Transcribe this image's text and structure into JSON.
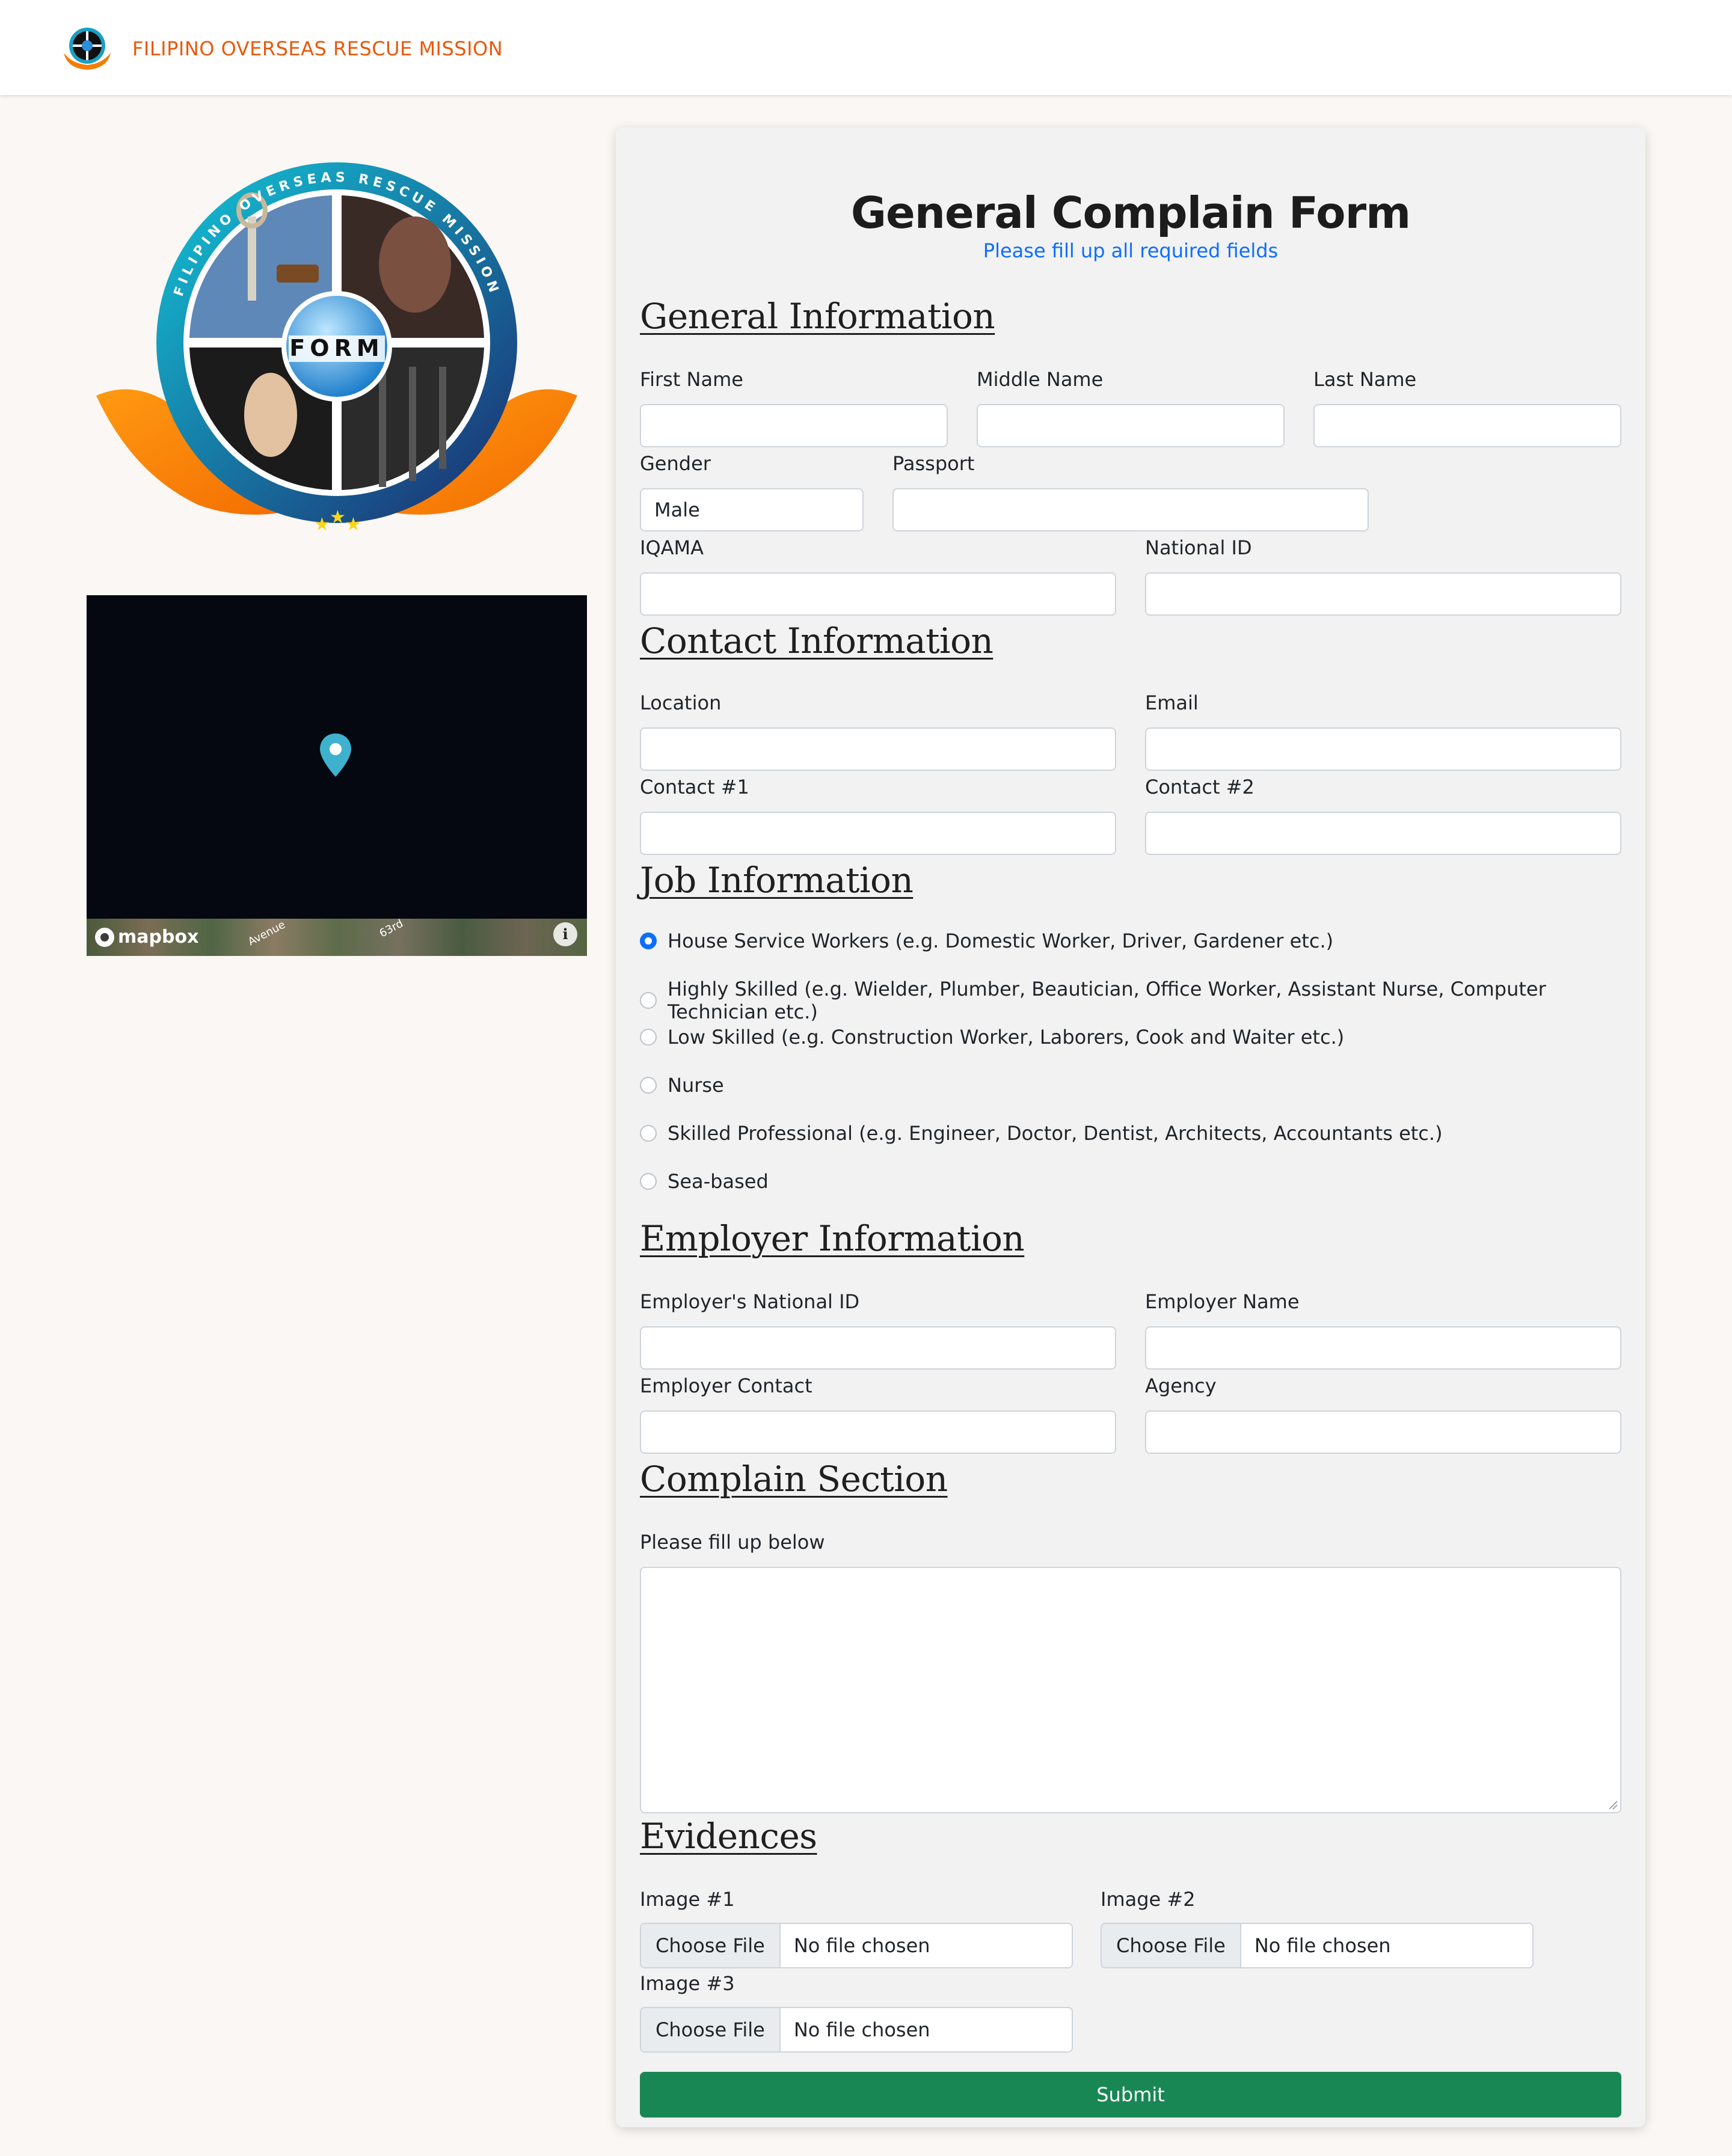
{
  "navbar": {
    "brand": "FILIPINO OVERSEAS RESCUE MISSION"
  },
  "emblem": {
    "ring_text": "FILIPINO OVERSEAS RESCUE MISSION",
    "center_text": "FORM"
  },
  "map": {
    "attribution": "mapbox",
    "streets": [
      "Avenue",
      "63rd"
    ],
    "info_label": "i"
  },
  "form": {
    "title": "General Complain Form",
    "subtitle": "Please fill up all required fields",
    "general": {
      "heading": "General Information",
      "first_name_label": "First Name",
      "middle_name_label": "Middle Name",
      "last_name_label": "Last Name",
      "gender_label": "Gender",
      "gender_value": "Male",
      "passport_label": "Passport",
      "iqama_label": "IQAMA",
      "national_id_label": "National ID"
    },
    "contact": {
      "heading": "Contact Information",
      "location_label": "Location",
      "email_label": "Email",
      "contact1_label": "Contact #1",
      "contact2_label": "Contact #2"
    },
    "job": {
      "heading": "Job Information",
      "options": [
        {
          "label": "House Service Workers (e.g. Domestic Worker, Driver, Gardener etc.)",
          "selected": true
        },
        {
          "label": "Highly Skilled (e.g. Wielder, Plumber, Beautician, Office Worker, Assistant Nurse, Computer Technician etc.)",
          "selected": false
        },
        {
          "label": "Low Skilled (e.g. Construction Worker, Laborers, Cook and Waiter etc.)",
          "selected": false
        },
        {
          "label": "Nurse",
          "selected": false
        },
        {
          "label": "Skilled Professional (e.g. Engineer, Doctor, Dentist, Architects, Accountants etc.)",
          "selected": false
        },
        {
          "label": "Sea-based",
          "selected": false
        }
      ]
    },
    "employer": {
      "heading": "Employer Information",
      "national_id_label": "Employer's National ID",
      "name_label": "Employer Name",
      "contact_label": "Employer Contact",
      "agency_label": "Agency"
    },
    "complain": {
      "heading": "Complain Section",
      "label": "Please fill up below"
    },
    "evidences": {
      "heading": "Evidences",
      "image1_label": "Image #1",
      "image2_label": "Image #2",
      "image3_label": "Image #3",
      "choose_label": "Choose File",
      "no_file_label": "No file chosen"
    },
    "submit_label": "Submit"
  },
  "colors": {
    "brand": "#e8590c",
    "primary": "#0d6efd",
    "submit": "#198754",
    "page_bg": "#fbf7f4",
    "card_bg": "#f2f2f2"
  }
}
